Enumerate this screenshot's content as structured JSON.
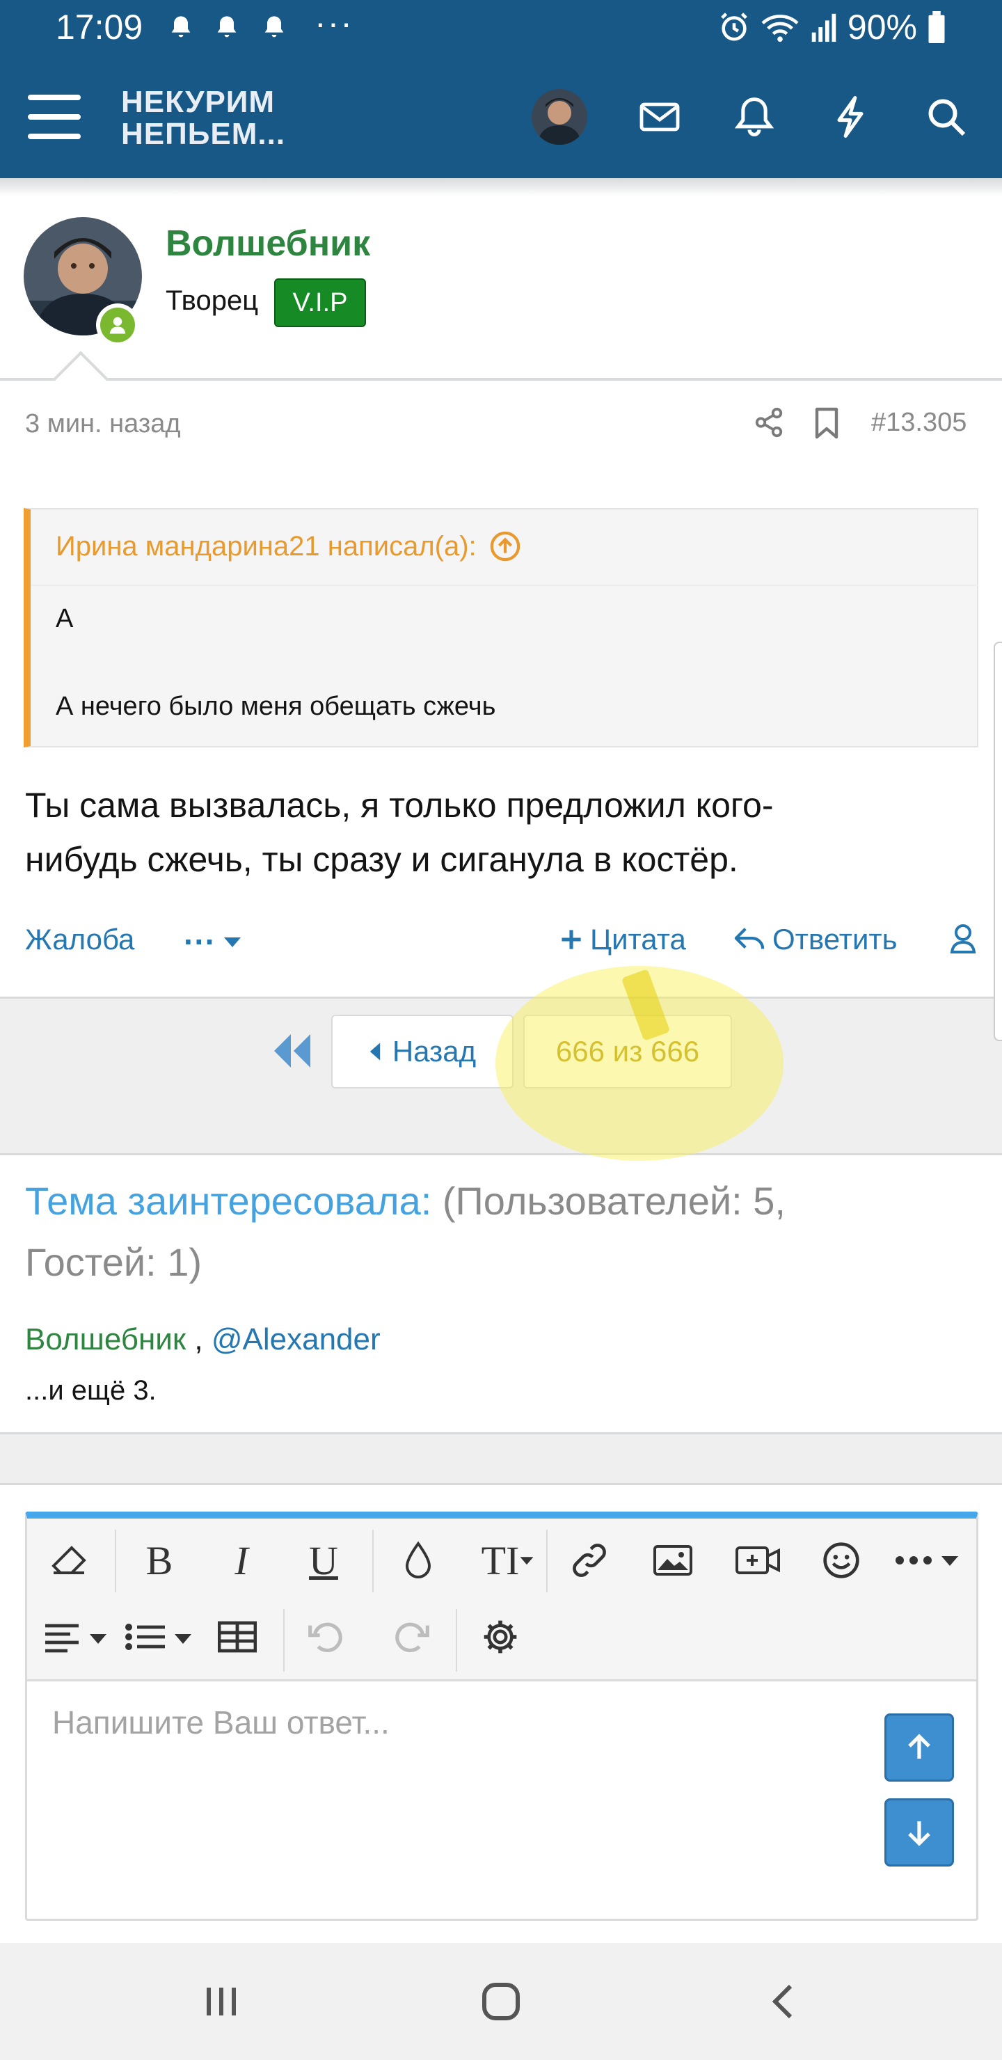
{
  "status_bar": {
    "time": "17:09",
    "dots": "···",
    "battery": "90%",
    "icons": [
      "bell-icon",
      "bell-icon",
      "bell-icon",
      "alarm-icon",
      "wifi-icon",
      "signal-icon",
      "battery-icon"
    ]
  },
  "app_bar": {
    "logo_line1": "НЕКУРИМ",
    "logo_line2": "НЕПЬЕМ...",
    "icons": [
      "menu-icon",
      "avatar",
      "mail-icon",
      "bell-icon",
      "bolt-icon",
      "search-icon"
    ],
    "colors": {
      "bar_bg": "#185886"
    }
  },
  "post": {
    "author": "Волшебник",
    "author_title": "Творец",
    "badge": "V.I.P",
    "time_ago": "3 мин. назад",
    "post_number": "#13.305",
    "quote": {
      "header": "Ирина мандарина21 написал(а):",
      "lines": [
        "А",
        "А нечего было меня обещать сжечь"
      ]
    },
    "body_line1": "Ты сама вызвалась, я только предложил кого-",
    "body_line2": "нибудь сжечь, ты сразу и сиганула в костёр.",
    "actions": {
      "report": "Жалоба",
      "more": "···",
      "quote": "Цитата",
      "reply": "Ответить"
    },
    "colors": {
      "author": "#2e8540",
      "badge_bg": "#168a24",
      "quote_accent": "#f0a030",
      "link": "#2577b1"
    }
  },
  "pager": {
    "back": "Назад",
    "count": "666 из 666"
  },
  "interested": {
    "title": "Тема заинтересовала:",
    "stats_line1": "(Пользователей: 5,",
    "stats_line2": "Гостей: 1)",
    "user1": "Волшебник",
    "separator": ",",
    "user2": "@Alexander",
    "more": "...и ещё 3."
  },
  "editor": {
    "placeholder": "Напишите Ваш ответ...",
    "toolbar_row1": [
      "eraser-icon",
      "bold-icon",
      "italic-icon",
      "underline-icon",
      "color-drop-icon",
      "text-size-icon",
      "link-icon",
      "image-icon",
      "video-icon",
      "emoji-icon",
      "more-icon"
    ],
    "toolbar_row2": [
      "align-icon",
      "list-icon",
      "table-icon",
      "undo-icon",
      "redo-icon",
      "settings-icon"
    ],
    "bold_glyph": "B",
    "italic_glyph": "I",
    "underline_glyph": "U",
    "textsize_glyph": "TI",
    "colors": {
      "accent": "#47a7eb",
      "scroll_btn": "#3d8fd0"
    }
  },
  "system_nav": [
    "recents-icon",
    "home-icon",
    "back-icon"
  ]
}
